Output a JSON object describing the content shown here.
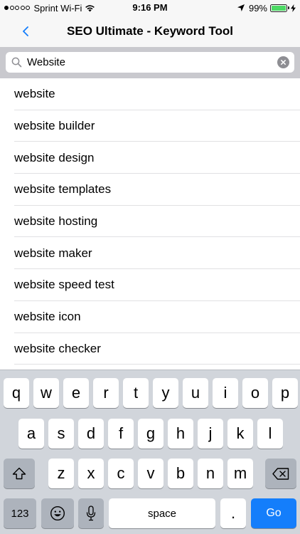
{
  "status_bar": {
    "carrier": "Sprint Wi-Fi",
    "time": "9:16 PM",
    "battery_percent": "99%",
    "battery_level": 0.99,
    "signal_bars": 1,
    "icons": [
      "wifi-icon",
      "location-arrow-icon",
      "battery-icon",
      "charging-bolt-icon"
    ]
  },
  "nav": {
    "title": "SEO Ultimate - Keyword Tool",
    "back_icon": "chevron-left-icon",
    "accent_color": "#147efb"
  },
  "search": {
    "value": "Website",
    "icons": [
      "search-icon",
      "clear-icon"
    ]
  },
  "results": [
    "website",
    "website builder",
    "website design",
    "website templates",
    "website hosting",
    "website maker",
    "website speed test",
    "website icon",
    "website checker"
  ],
  "keyboard": {
    "row1": [
      "q",
      "w",
      "e",
      "r",
      "t",
      "y",
      "u",
      "i",
      "o",
      "p"
    ],
    "row2": [
      "a",
      "s",
      "d",
      "f",
      "g",
      "h",
      "j",
      "k",
      "l"
    ],
    "row3": [
      "z",
      "x",
      "c",
      "v",
      "b",
      "n",
      "m"
    ],
    "numbers_label": "123",
    "space_label": "space",
    "period_label": ".",
    "go_label": "Go",
    "icons": [
      "shift-icon",
      "backspace-icon",
      "emoji-icon",
      "microphone-icon"
    ]
  }
}
